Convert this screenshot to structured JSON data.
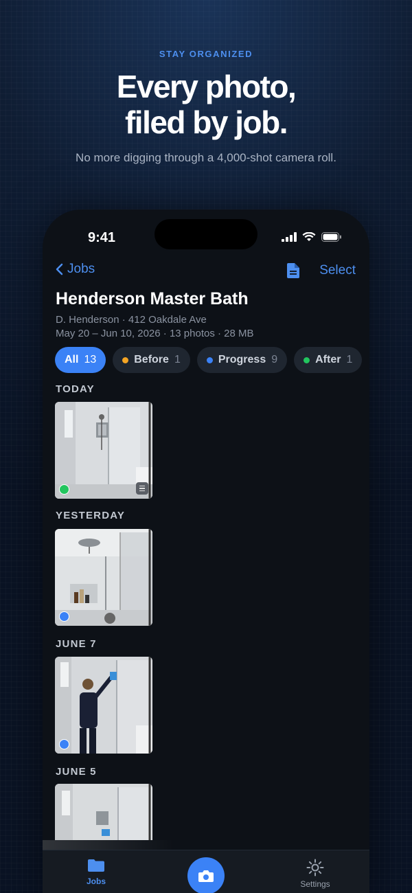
{
  "hero": {
    "eyebrow": "STAY ORGANIZED",
    "headline_line1": "Every photo,",
    "headline_line2": "filed by job.",
    "subhead": "No more digging through a 4,000-shot camera roll."
  },
  "status_bar": {
    "time": "9:41"
  },
  "nav": {
    "back_label": "Jobs",
    "select_label": "Select",
    "doc_icon": "document-icon"
  },
  "job": {
    "title": "Henderson Master Bath",
    "client_line": "D. Henderson · 412 Oakdale Ave",
    "detail_line": "May 20 – Jun 10, 2026 · 13 photos · 28 MB"
  },
  "filters": [
    {
      "label": "All",
      "count": "13",
      "active": true,
      "color": ""
    },
    {
      "label": "Before",
      "count": "1",
      "active": false,
      "color": "#f5a524"
    },
    {
      "label": "Progress",
      "count": "9",
      "active": false,
      "color": "#3b82f6"
    },
    {
      "label": "After",
      "count": "1",
      "active": false,
      "color": "#22c55e"
    }
  ],
  "sections": [
    {
      "label": "TODAY",
      "tag_color": "#22c55e",
      "has_note": true
    },
    {
      "label": "YESTERDAY",
      "tag_color": "#3b82f6",
      "has_note": false
    },
    {
      "label": "JUNE 7",
      "tag_color": "#3b82f6",
      "has_note": false
    },
    {
      "label": "JUNE 5",
      "tag_color": "#3b82f6",
      "has_note": false
    }
  ],
  "tabbar": {
    "jobs_label": "Jobs",
    "settings_label": "Settings",
    "camera_icon": "camera-icon"
  },
  "colors": {
    "accent": "#3b82f6",
    "link": "#4d8fef",
    "background": "#0d1117"
  }
}
